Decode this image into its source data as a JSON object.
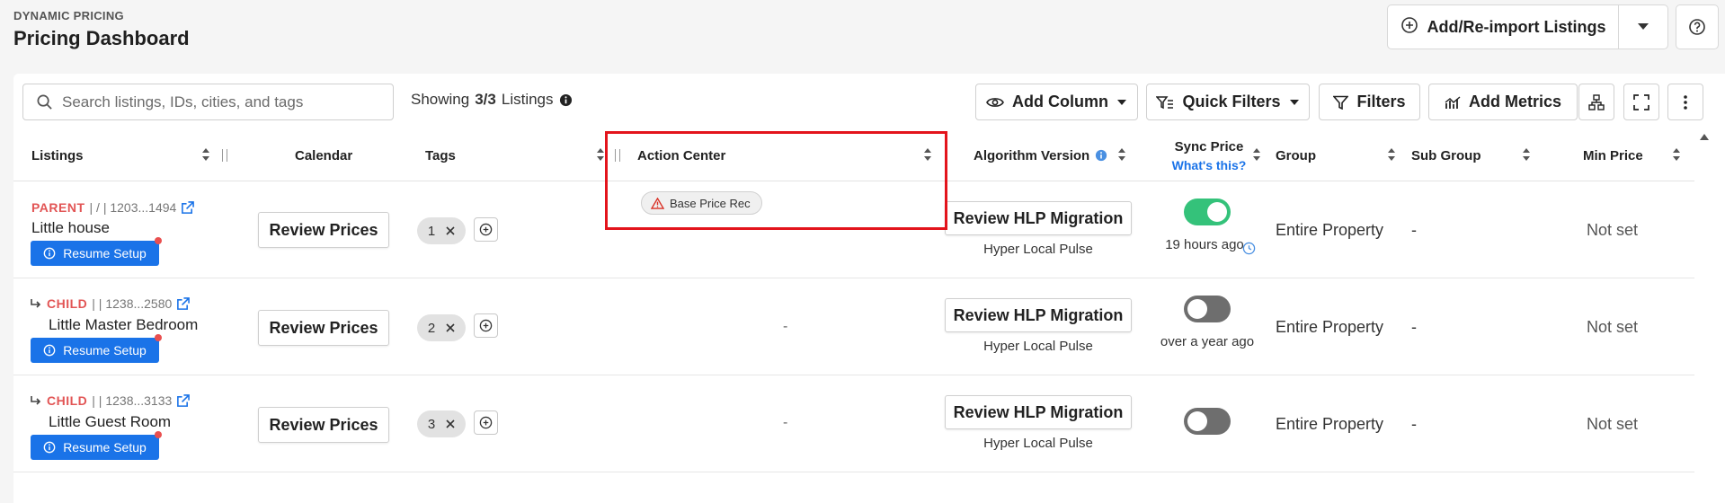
{
  "header": {
    "eyebrow": "DYNAMIC PRICING",
    "title": "Pricing Dashboard",
    "import_label": "Add/Re-import Listings"
  },
  "toolbar": {
    "search_placeholder": "Search listings, IDs, cities, and tags",
    "showing_prefix": "Showing",
    "showing_count": "3/3",
    "showing_suffix": "Listings",
    "add_column": "Add Column",
    "quick_filters": "Quick Filters",
    "filters": "Filters",
    "add_metrics": "Add Metrics"
  },
  "columns": {
    "listings": "Listings",
    "calendar": "Calendar",
    "tags": "Tags",
    "action_center": "Action Center",
    "algorithm_version": "Algorithm Version",
    "sync_price": "Sync Price",
    "whats_this": "What's this?",
    "group": "Group",
    "sub_group": "Sub Group",
    "min_price": "Min Price"
  },
  "rows": [
    {
      "type": "PARENT",
      "meta": "| / | 1203...1494",
      "name": "Little house",
      "resume": "Resume Setup",
      "review": "Review Prices",
      "tag_count": "1",
      "action": "Base Price Rec",
      "hlp": "Review HLP Migration",
      "algo": "Hyper Local Pulse",
      "sync_on": true,
      "sync_time": "19 hours ago",
      "group": "Entire Property",
      "sub_group": "-",
      "min_price": "Not set"
    },
    {
      "type": "CHILD",
      "meta": "|  | 1238...2580",
      "name": "Little Master Bedroom",
      "resume": "Resume Setup",
      "review": "Review Prices",
      "tag_count": "2",
      "action": "-",
      "hlp": "Review HLP Migration",
      "algo": "Hyper Local Pulse",
      "sync_on": false,
      "sync_time": "over a year ago",
      "group": "Entire Property",
      "sub_group": "-",
      "min_price": "Not set"
    },
    {
      "type": "CHILD",
      "meta": "|  | 1238...3133",
      "name": "Little Guest Room",
      "resume": "Resume Setup",
      "review": "Review Prices",
      "tag_count": "3",
      "action": "-",
      "hlp": "Review HLP Migration",
      "algo": "Hyper Local Pulse",
      "sync_on": false,
      "sync_time": "",
      "group": "Entire Property",
      "sub_group": "-",
      "min_price": "Not set"
    }
  ],
  "colors": {
    "accent": "#1a73e8",
    "toggle_on": "#34c27a",
    "toggle_off": "#6e6e6e",
    "parent_label": "#e25555",
    "highlight": "#e3141c"
  }
}
